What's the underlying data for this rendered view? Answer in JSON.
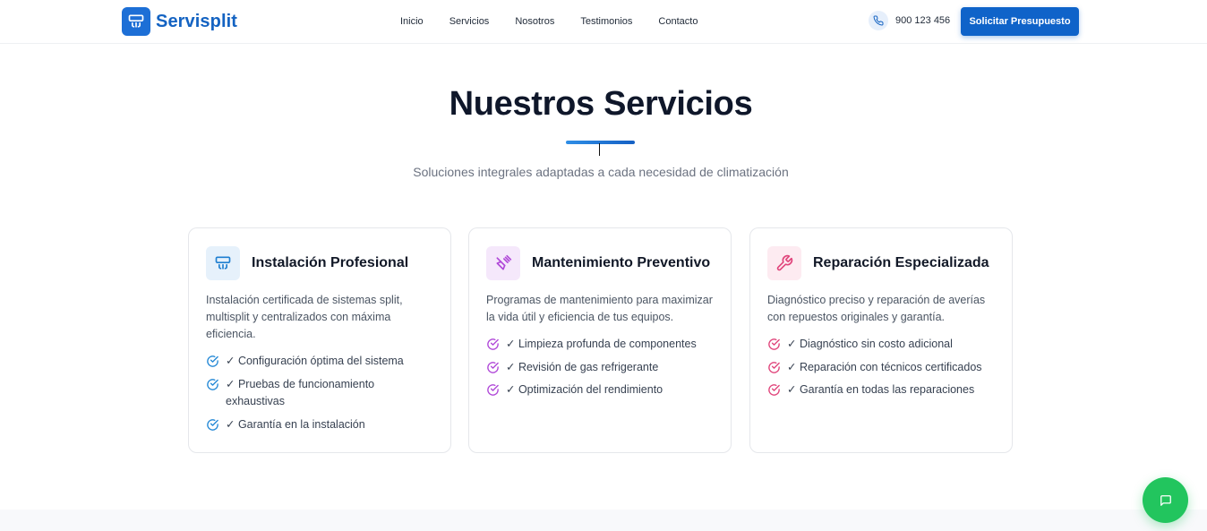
{
  "brand": {
    "name": "Servisplit",
    "logo_icon": "air-conditioner-icon"
  },
  "nav": [
    "Inicio",
    "Servicios",
    "Nosotros",
    "Testimonios",
    "Contacto"
  ],
  "header": {
    "phone": "900 123 456",
    "cta_label": "Solicitar Presupuesto"
  },
  "section": {
    "title": "Nuestros Servicios",
    "subtitle": "Soluciones integrales adaptadas a cada necesidad de climatización"
  },
  "colors": {
    "primary": "#0f63c9",
    "blue": "#2589d6",
    "purple": "#b048d8",
    "pink": "#e0457b",
    "chat": "#22c55e"
  },
  "cards": [
    {
      "title": "Instalación Profesional",
      "icon": "air-conditioner-icon",
      "description": "Instalación certificada de sistemas split, multisplit y centralizados con máxima eficiencia.",
      "features": [
        "✓ Configuración óptima del sistema",
        "✓ Pruebas de funcionamiento exhaustivas",
        "✓ Garantía en la instalación"
      ]
    },
    {
      "title": "Mantenimiento Preventivo",
      "icon": "spray-icon",
      "description": "Programas de mantenimiento para maximizar la vida útil y eficiencia de tus equipos.",
      "features": [
        "✓ Limpieza profunda de componentes",
        "✓ Revisión de gas refrigerante",
        "✓ Optimización del rendimiento"
      ]
    },
    {
      "title": "Reparación Especializada",
      "icon": "wrench-icon",
      "description": "Diagnóstico preciso y reparación de averías con repuestos originales y garantía.",
      "features": [
        "✓ Diagnóstico sin costo adicional",
        "✓ Reparación con técnicos certificados",
        "✓ Garantía en todas las reparaciones"
      ]
    }
  ],
  "chat_icon": "chat-icon"
}
